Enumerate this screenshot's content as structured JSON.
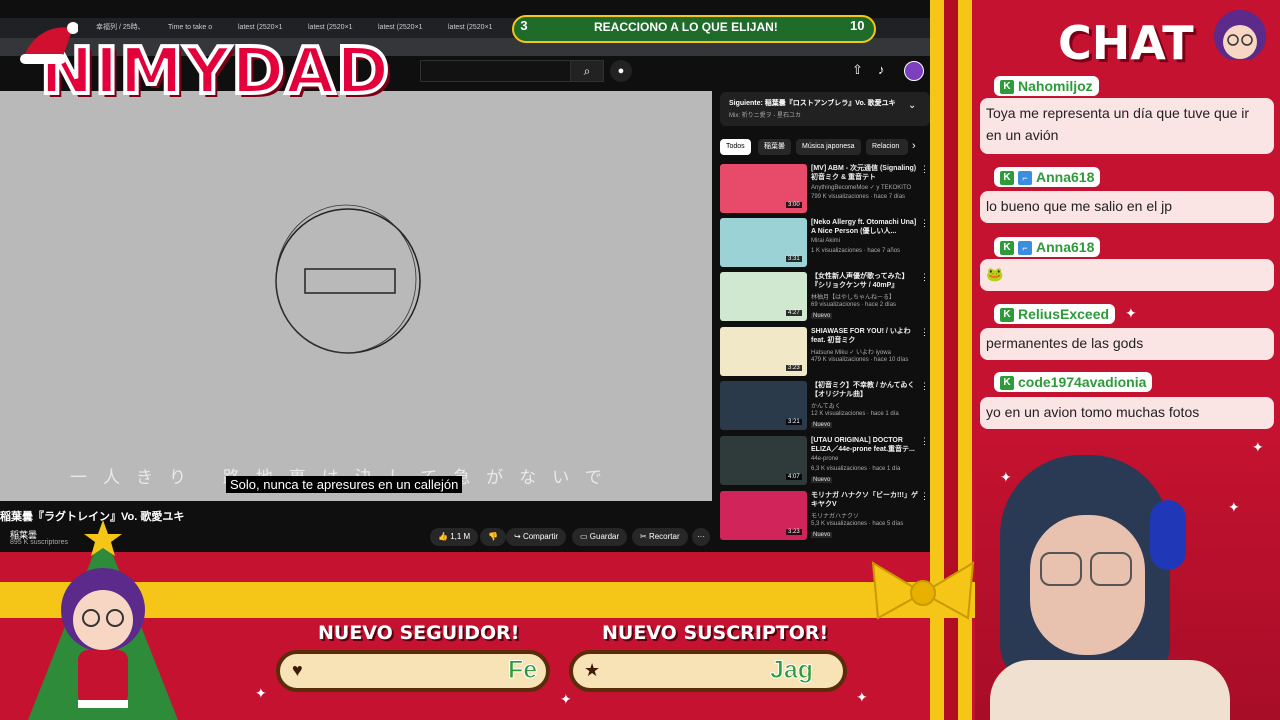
{
  "browser": {
    "tabs": [
      "幸福列 / 25時、",
      "Time to take o",
      "latest (2520×1",
      "latest (2520×1",
      "latest (2520×1",
      "latest (2520×1"
    ],
    "search_icon": "search-icon",
    "mic_icon": "mic-icon"
  },
  "banner": {
    "left_number": "3",
    "text": "REACCIONO A LO QUE ELIJAN!",
    "right_number": "10"
  },
  "logo": {
    "text": "NIMYDAD"
  },
  "player": {
    "lyrics": "一人きり 路地裏は決して急がないで",
    "subtitle": "Solo, nunca te apresures en un callejón",
    "video_title": "稲葉曇『ラグトレイン』Vo. 歌愛ユキ",
    "channel_name": "稲葉曇",
    "channel_subs": "895 K suscriptores",
    "like_count": "1,1 M",
    "share_label": "Compartir",
    "save_label": "Guardar",
    "clip_label": "Recortar",
    "more_label": "···"
  },
  "sidebar": {
    "up_next_title": "Siguiente: 稲葉曇『ロストアンブレラ』Vo. 歌愛ユキ",
    "up_next_sub": "Mix: 祈りニ愛ヲ - 星石ユカ",
    "chips": [
      "Todos",
      "稲葉曇",
      "Música japonesa",
      "Relacion"
    ],
    "recs": [
      {
        "title": "[MV] ABM - 次元通信 (Signaling) 初音ミク & 重音テト",
        "channel": "AnythingBecomeMoe ✓ y TEKOKITO",
        "meta": "799 K visualizaciones · hace 7 días",
        "badge": "",
        "duration": "3:00",
        "color": "#e84a6a"
      },
      {
        "title": "[Neko Allergy ft. Otomachi Una] A Nice Person (優しい人...",
        "channel": "Mirai Akimi",
        "meta": "1 K visualizaciones · hace 7 años",
        "badge": "",
        "duration": "3:31",
        "color": "#9ad2d6"
      },
      {
        "title": "【女性新人声優が歌ってみた】『シリョクケンサ / 40mP』",
        "channel": "林柚月【はやしちゃんねーる】",
        "meta": "69 visualizaciones · hace 2 días",
        "badge": "Nuevo",
        "duration": "4:27",
        "color": "#cfe8cf"
      },
      {
        "title": "SHIAWASE FOR YOU! / いよわ feat. 初音ミク",
        "channel": "Hatsune Miku ✓ いよわ iyowa",
        "meta": "479 K visualizaciones · hace 10 días",
        "badge": "",
        "duration": "3:23",
        "color": "#f1e8c8"
      },
      {
        "title": "【初音ミク】不幸教 / かんてゐく【オリジナル曲】",
        "channel": "かんてゐく",
        "meta": "12 K visualizaciones · hace 1 día",
        "badge": "Nuevo",
        "duration": "3:21",
        "color": "#2b3a4a"
      },
      {
        "title": "[UTAU ORIGINAL] DOCTOR ELIZA／44e-prone feat.重音テ...",
        "channel": "44e-prone",
        "meta": "6,3 K visualizaciones · hace 1 día",
        "badge": "Nuevo",
        "duration": "4:07",
        "color": "#2f3a3a"
      },
      {
        "title": "モリナガ ハナクソ「ビーカ!!!」ゲキヤクV",
        "channel": "モリナガハナクソ",
        "meta": "5,3 K visualizaciones · hace 5 días",
        "badge": "Nuevo",
        "duration": "3:23",
        "color": "#d0245a"
      }
    ]
  },
  "chat": {
    "title": "CHAT",
    "messages": [
      {
        "user": "Nahomiljoz",
        "text": "Toya me representa un día que tuve que ir en un avión"
      },
      {
        "user": "Anna618",
        "text": "lo bueno que me salio en el jp"
      },
      {
        "user": "Anna618",
        "text": "🐸"
      },
      {
        "user": "ReliusExceed",
        "text": "permanentes de las gods"
      },
      {
        "user": "code1974avadionia",
        "text": "yo en un avion tomo muchas fotos"
      }
    ]
  },
  "alerts": {
    "follower_label": "NUEVO SEGUIDOR!",
    "follower_name": "Fe",
    "subscriber_label": "NUEVO SUSCRIPTOR!",
    "subscriber_name": "Jag"
  },
  "colors": {
    "overlay_red": "#c41230",
    "gold": "#f5c518",
    "chat_green": "#2e9b3a"
  }
}
